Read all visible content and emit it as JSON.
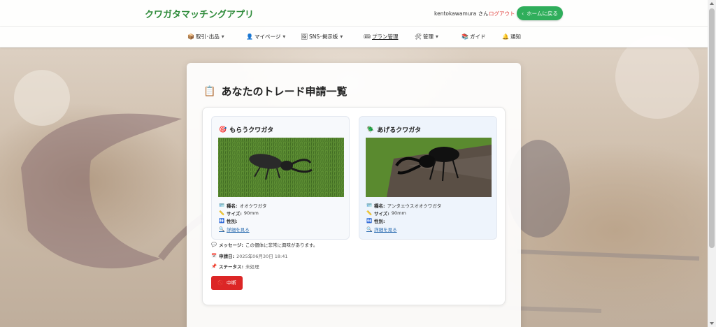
{
  "header": {
    "brand": "クワガタマッチングアプリ",
    "user": "kentokawamura さん",
    "logout": "ログアウト",
    "home_button": "ホームに戻る"
  },
  "nav": {
    "items": [
      {
        "label": "取引･出品",
        "icon": "box-icon",
        "dropdown": true
      },
      {
        "label": "マイページ",
        "icon": "person-icon",
        "dropdown": true
      },
      {
        "label": "SNS･掲示板",
        "icon": "image-icon",
        "dropdown": true
      },
      {
        "label": "プラン管理",
        "icon": "plan-icon",
        "dropdown": false
      },
      {
        "label": "管理",
        "icon": "tools-icon",
        "dropdown": true
      },
      {
        "label": "ガイド",
        "icon": "book-icon",
        "dropdown": false
      },
      {
        "label": "通知",
        "icon": "bell-icon",
        "dropdown": false
      }
    ]
  },
  "main": {
    "title": "あなたのトレード申請一覧",
    "request": {
      "receive": {
        "heading": "もらうクワガタ",
        "species_label": "種名:",
        "species": "オオクワガタ",
        "size_label": "サイズ:",
        "size": "90mm",
        "sex_label": "性別:",
        "sex": "",
        "detail_link": "詳細を見る"
      },
      "give": {
        "heading": "あげるクワガタ",
        "species_label": "種名:",
        "species": "アンタエウスオオクワガタ",
        "size_label": "サイズ:",
        "size": "90mm",
        "sex_label": "性別:",
        "sex": "",
        "detail_link": "詳細を見る"
      },
      "message_label": "メッセージ:",
      "message": "この個体に非常に興味があります。",
      "date_label": "申請日:",
      "date": "2025年06月30日 18:41",
      "status_label": "ステータス:",
      "status": "未処理",
      "cancel_button": "中断"
    }
  },
  "colors": {
    "brand": "#2e8b3a",
    "home_button": "#2fae5b",
    "logout": "#e0413f",
    "cancel_button": "#dc2626",
    "link": "#2b6cb0"
  }
}
